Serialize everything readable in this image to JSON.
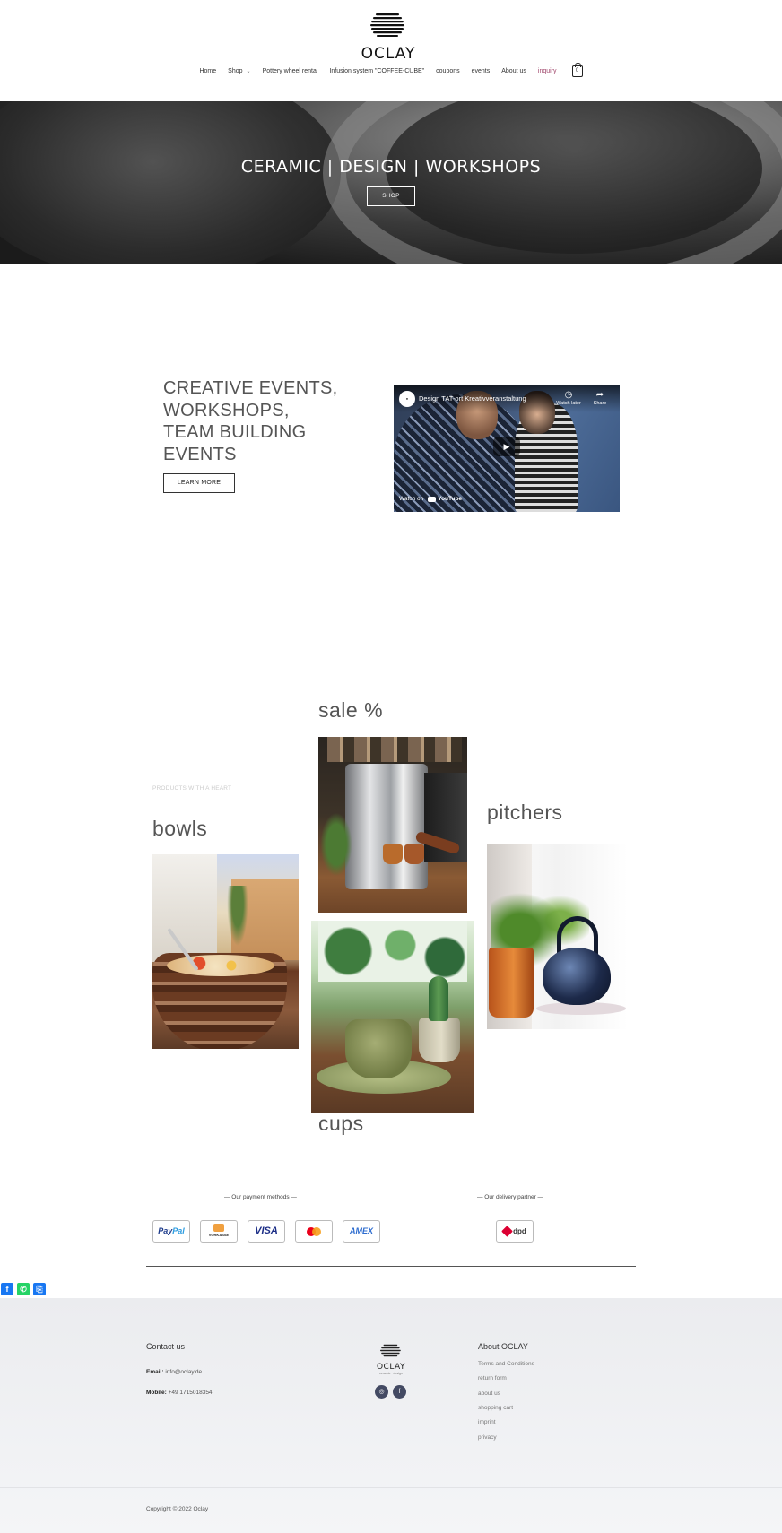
{
  "header": {
    "logo_text": "OCLAY",
    "nav": {
      "home": "Home",
      "shop": "Shop",
      "pottery": "Pottery wheel rental",
      "infusion": "Infusion system \"COFFEE-CUBE\"",
      "coupons": "coupons",
      "events": "events",
      "about": "About us",
      "inquiry": "inquiry",
      "cart_count": "0"
    }
  },
  "hero": {
    "title": "CERAMIC | DESIGN | WORKSHOPS",
    "button": "SHOP"
  },
  "events": {
    "title_lines": [
      "CREATIVE EVENTS,",
      "WORKSHOPS,",
      "TEAM BUILDING",
      "EVENTS"
    ],
    "button": "LEARN MORE",
    "video": {
      "title": "Design TAT-ort Kreativveranstaltung",
      "watch_later": "Watch later",
      "share": "Share",
      "watch_on": "Watch on",
      "youtube": "YouTube"
    }
  },
  "products": {
    "label": "PRODUCTS WITH A HEART",
    "sale": "sale %",
    "bowls": "bowls",
    "pitchers": "pitchers",
    "cups": "cups"
  },
  "payments": {
    "methods_title": "— Our payment methods —",
    "delivery_title": "— Our delivery partner —",
    "paypal_a": "Pay",
    "paypal_b": "Pal",
    "vorkasse": "VORKASSE",
    "visa": "VISA",
    "amex": "AMEX",
    "dpd": "dpd",
    "colors": {
      "mc_red": "#eb001b",
      "mc_orange": "#f79e1b",
      "dpd_red": "#dc0032"
    }
  },
  "share_bar": {
    "facebook": "f",
    "whatsapp": "✆",
    "copy": "⎘"
  },
  "footer": {
    "contact_title": "Contact us",
    "email_label": "Email:",
    "email": "info@oclay.de",
    "mobile_label": "Mobile:",
    "mobile": "+49 1715018354",
    "logo_text": "OCLAY",
    "logo_sub": "ceramic · design",
    "about_title": "About OCLAY",
    "links": [
      "Terms and Conditions",
      "return form",
      "about us",
      "shopping cart",
      "imprint",
      "privacy"
    ],
    "copyright": "Copyright © 2022 Oclay"
  }
}
